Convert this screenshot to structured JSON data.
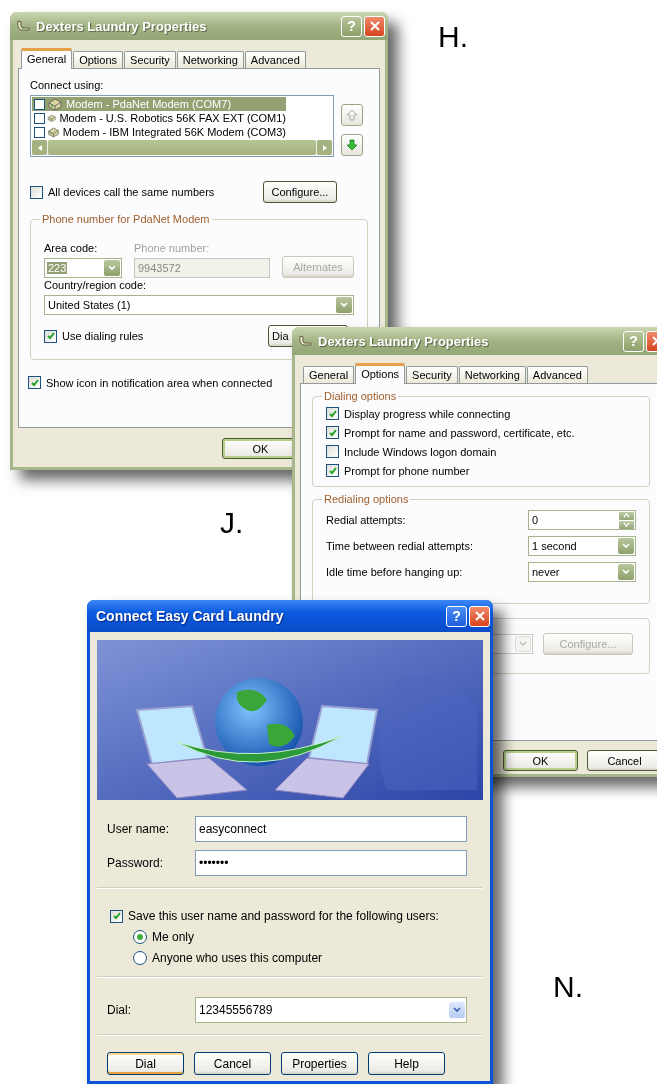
{
  "properties_general": {
    "figure_label": "H.",
    "title": "Dexters Laundry Properties",
    "help_button": "?",
    "tabs": [
      {
        "label": "General",
        "selected": true
      },
      {
        "label": "Options",
        "selected": false
      },
      {
        "label": "Security",
        "selected": false
      },
      {
        "label": "Networking",
        "selected": false
      },
      {
        "label": "Advanced",
        "selected": false
      }
    ],
    "connect_using_label": "Connect using:",
    "devices": [
      {
        "label": "Modem - PdaNet Modem (COM7)",
        "checked": false,
        "selected": true
      },
      {
        "label": "Modem - U.S. Robotics 56K FAX EXT (COM1)",
        "checked": false,
        "selected": false
      },
      {
        "label": "Modem - IBM Integrated 56K Modem (COM3)",
        "checked": false,
        "selected": false
      }
    ],
    "all_devices": {
      "label": "All devices call the same numbers",
      "checked": false
    },
    "configure_button": "Configure...",
    "phone_group": {
      "title": "Phone number for PdaNet Modem",
      "area_code_label": "Area code:",
      "area_code": "223",
      "phone_number": {
        "label": "Phone number:",
        "value": "9943572",
        "disabled": true
      },
      "alternates_button": {
        "label": "Alternates",
        "disabled": true
      },
      "country_label": "Country/region code:",
      "country": "United States (1)",
      "dialing_rules": {
        "label": "Use dialing rules",
        "checked": true
      },
      "dialing_rules_button": "Dia"
    },
    "show_icon": {
      "label": "Show icon in notification area when connected",
      "checked": true
    },
    "ok_button": "OK"
  },
  "properties_options": {
    "figure_label": "J.",
    "title": "Dexters Laundry Properties",
    "help_button": "?",
    "tabs": [
      {
        "label": "General",
        "selected": false
      },
      {
        "label": "Options",
        "selected": true
      },
      {
        "label": "Security",
        "selected": false
      },
      {
        "label": "Networking",
        "selected": false
      },
      {
        "label": "Advanced",
        "selected": false
      }
    ],
    "dialing_group": {
      "title": "Dialing options",
      "options": [
        {
          "label": "Display progress while connecting",
          "checked": true
        },
        {
          "label": "Prompt for name and password, certificate, etc.",
          "checked": true
        },
        {
          "label": "Include Windows logon domain",
          "checked": false
        },
        {
          "label": "Prompt for phone number",
          "checked": true
        }
      ]
    },
    "redialing_group": {
      "title": "Redialing options",
      "settings": [
        {
          "kind": "spinner",
          "label": "Redial attempts:",
          "value": "0"
        },
        {
          "kind": "dropdown",
          "label": "Time between redial attempts:",
          "value": "1 second"
        },
        {
          "kind": "dropdown",
          "label": "Idle time before hanging up:",
          "value": "never"
        }
      ]
    },
    "hidden_group": {
      "configure_button": {
        "label": "Configure...",
        "disabled": true
      }
    },
    "buttons": [
      "OK",
      "Cancel"
    ]
  },
  "connect_dialog": {
    "figure_label": "N.",
    "title": "Connect Easy Card Laundry",
    "help_button": "?",
    "user_name": {
      "label": "User name:",
      "value": "easyconnect"
    },
    "password": {
      "label": "Password:",
      "value": "•••••••"
    },
    "save_credentials": {
      "label": "Save this user name and password for the following users:",
      "checked": true
    },
    "save_for": [
      {
        "label": "Me only",
        "selected": true
      },
      {
        "label": "Anyone who uses this computer",
        "selected": false
      }
    ],
    "dial": {
      "label": "Dial:",
      "value": "12345556789"
    },
    "buttons": [
      {
        "label": "Dial",
        "default": true
      },
      {
        "label": "Cancel",
        "default": false
      },
      {
        "label": "Properties",
        "default": false
      },
      {
        "label": "Help",
        "default": false
      }
    ]
  }
}
